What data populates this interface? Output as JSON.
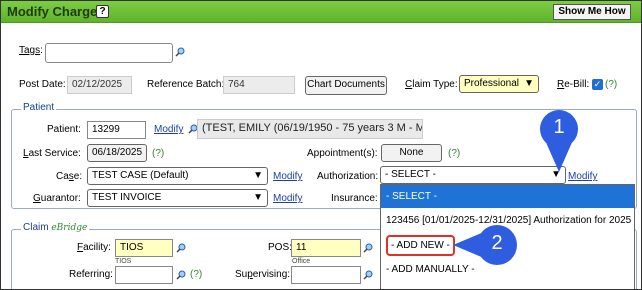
{
  "window": {
    "title": "Modify Charge",
    "help": "?",
    "show_me_how": "Show Me How"
  },
  "tags": {
    "label": "Tags",
    "colon": ":",
    "value": ""
  },
  "post_date": {
    "label": "Post Date:",
    "value": "02/12/2025"
  },
  "reference_batch": {
    "label": "Reference Batch:",
    "value": "764"
  },
  "chart_documents": "Chart Documents",
  "claim_type": {
    "label_u": "C",
    "label_rest": "laim Type:",
    "value": "Professional"
  },
  "rebill": {
    "label_u": "R",
    "label_rest": "e-Bill:",
    "checked": true,
    "help": "(?)"
  },
  "patient_section": {
    "legend": "Patient",
    "patient": {
      "label": "Patient:",
      "value": "13299",
      "modify": "Modify",
      "info": "(TEST, EMILY (06/19/1950 - 75 years 3 M - M)"
    },
    "last_service": {
      "label_u": "L",
      "label_rest": "ast Service:",
      "value": "06/18/2025",
      "help": "(?)"
    },
    "appointment": {
      "label": "Appointment(s):",
      "value": "None",
      "help": "(?)"
    },
    "case": {
      "label_pre": "Ca",
      "label_u": "s",
      "label_rest": "e:",
      "value": "TEST CASE (Default)",
      "modify": "Modify"
    },
    "authorization": {
      "label": "Authorization:",
      "value": "- SELECT -",
      "modify": "Modify"
    },
    "guarantor": {
      "label_u": "G",
      "label_rest": "uarantor:",
      "value": "TEST INVOICE",
      "modify": "Modify"
    },
    "insurance": {
      "label": "Insurance:"
    }
  },
  "claim_section": {
    "legend": "Claim",
    "legend_brand": "eBridge",
    "facility": {
      "label_u": "F",
      "label_rest": "acility:",
      "value": "TIOS",
      "sub": "TIOS"
    },
    "pos": {
      "label": "POS:",
      "value": "11",
      "sub": "Office"
    },
    "referring": {
      "label": "Referring:",
      "help": "(?)"
    },
    "supervising": {
      "label_pre": "Su",
      "label_u": "p",
      "label_rest": "ervising:",
      "help": "(?)"
    }
  },
  "auth_dropdown": {
    "options": [
      "- SELECT -",
      "123456 [01/01/2025-12/31/2025] Authorization for 2025",
      "- ADD NEW -",
      "- ADD MANUALLY -"
    ],
    "selected_index": 0
  },
  "callouts": [
    "1",
    "2"
  ],
  "colors": {
    "titlebar": "#6cbf35",
    "callout": "#2f5de0",
    "highlight": "#e0302a",
    "selected": "#1f73d6"
  }
}
